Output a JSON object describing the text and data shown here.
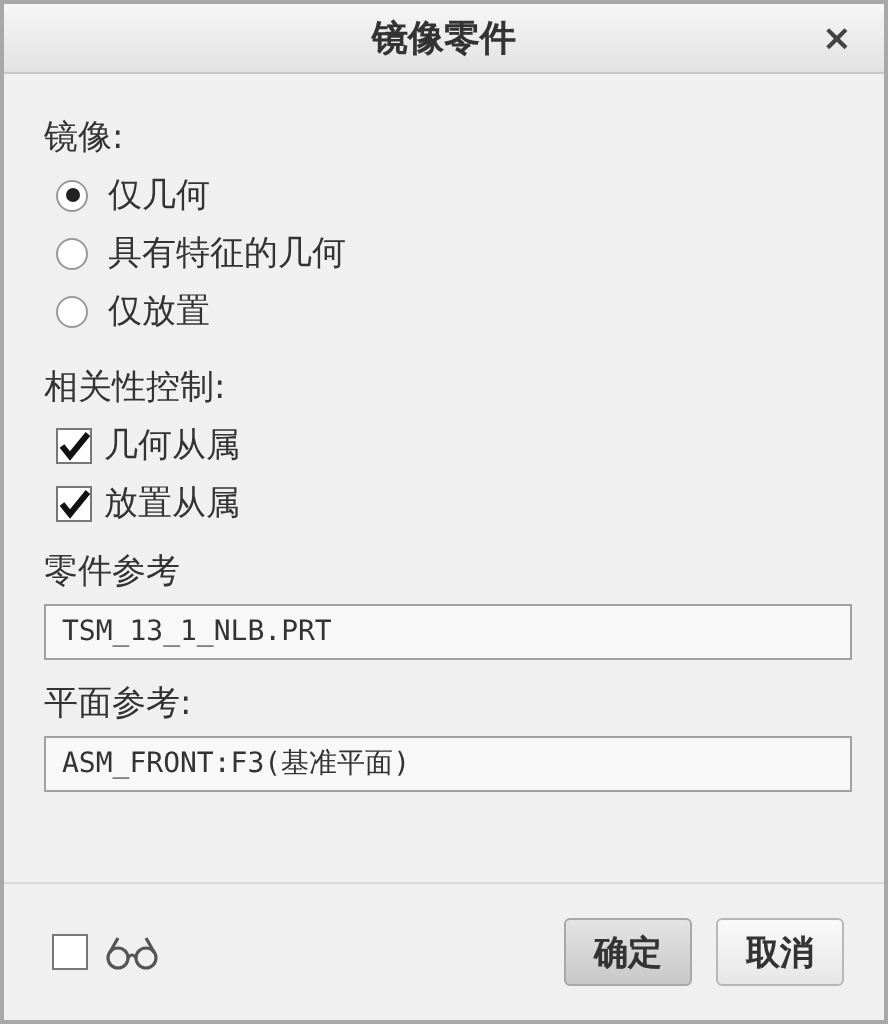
{
  "window": {
    "title": "镜像零件",
    "close": "×"
  },
  "mirror": {
    "label": "镜像:",
    "options": [
      {
        "label": "仅几何",
        "selected": true
      },
      {
        "label": "具有特征的几何",
        "selected": false
      },
      {
        "label": "仅放置",
        "selected": false
      }
    ]
  },
  "dependency": {
    "label": "相关性控制:",
    "options": [
      {
        "label": "几何从属",
        "checked": true
      },
      {
        "label": "放置从属",
        "checked": true
      }
    ]
  },
  "part_reference": {
    "label": "零件参考",
    "value": "TSM_13_1_NLB.PRT"
  },
  "plane_reference": {
    "label": "平面参考:",
    "value": "ASM_FRONT:F3(基准平面)"
  },
  "preview": {
    "checked": false
  },
  "buttons": [
    {
      "label": "确定",
      "kind": "primary"
    },
    {
      "label": "取消",
      "kind": "default"
    }
  ]
}
